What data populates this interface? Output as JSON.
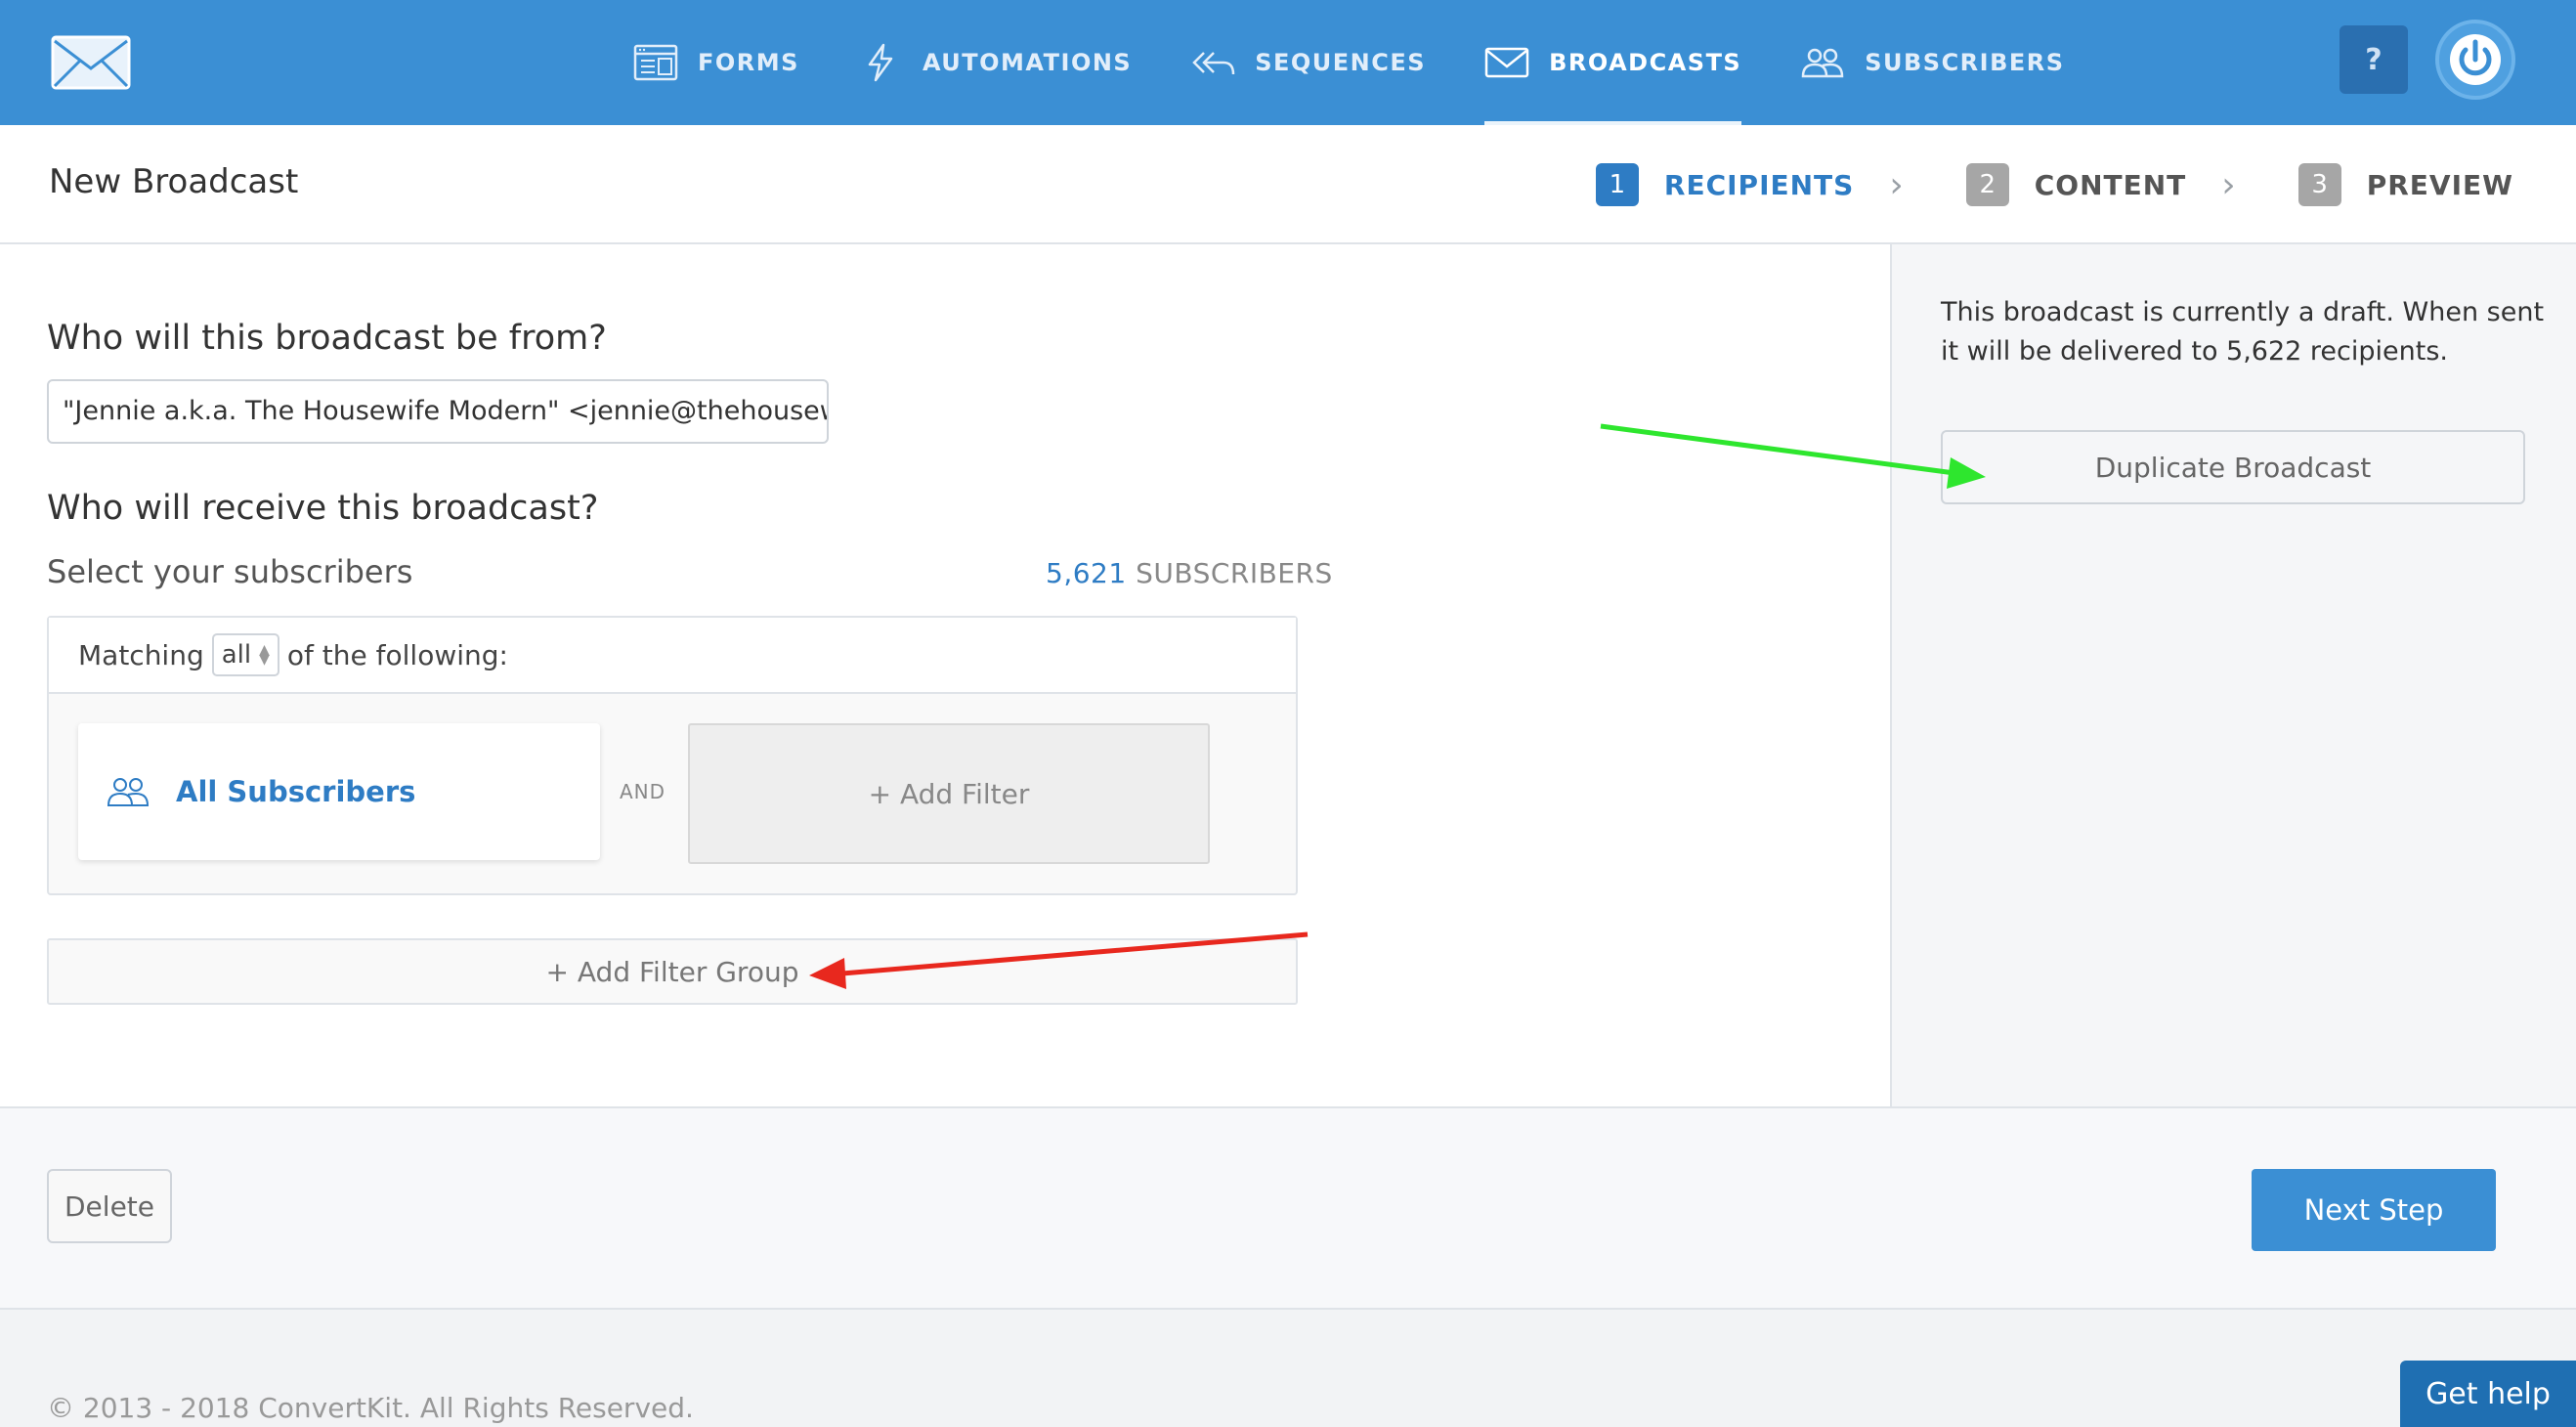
{
  "nav": {
    "items": [
      {
        "label": "FORMS",
        "icon": "forms-icon"
      },
      {
        "label": "AUTOMATIONS",
        "icon": "lightning-icon"
      },
      {
        "label": "SEQUENCES",
        "icon": "reply-all-icon"
      },
      {
        "label": "BROADCASTS",
        "icon": "envelope-icon",
        "active": true
      },
      {
        "label": "SUBSCRIBERS",
        "icon": "people-icon"
      }
    ],
    "help_label": "?"
  },
  "header": {
    "title": "New Broadcast",
    "steps": [
      {
        "num": "1",
        "label": "RECIPIENTS",
        "active": true
      },
      {
        "num": "2",
        "label": "CONTENT"
      },
      {
        "num": "3",
        "label": "PREVIEW"
      }
    ]
  },
  "main": {
    "from_question": "Who will this broadcast be from?",
    "from_value": "\"Jennie a.k.a. The Housewife Modern\" <jennie@thehousewi",
    "receive_question": "Who will receive this broadcast?",
    "select_label": "Select your subscribers",
    "subscriber_count": "5,621",
    "subscriber_unit": "SUBSCRIBERS",
    "matching_prefix": "Matching",
    "matching_value": "all",
    "matching_suffix": "of the following:",
    "all_subscribers": "All Subscribers",
    "and_label": "AND",
    "add_filter": "+ Add Filter",
    "add_filter_group": "+ Add Filter Group"
  },
  "sidebar": {
    "draft_note": "This broadcast is currently a draft. When sent it will be delivered to 5,622 recipients.",
    "duplicate_label": "Duplicate Broadcast"
  },
  "actions": {
    "delete_label": "Delete",
    "next_label": "Next Step"
  },
  "footer": {
    "copyright": "© 2013 - 2018 ConvertKit. All Rights Reserved.",
    "get_help": "Get help"
  },
  "colors": {
    "brand_blue": "#3b8fd4",
    "link_blue": "#2e7cc4",
    "annotation_green": "#2ee62e",
    "annotation_red": "#e8281e"
  }
}
